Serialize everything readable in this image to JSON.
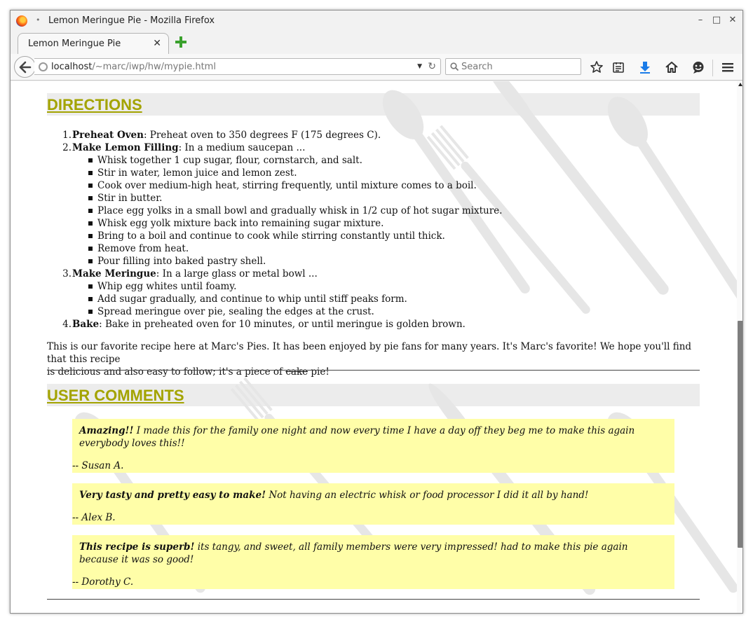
{
  "window": {
    "title": "Lemon Meringue Pie - Mozilla Firefox"
  },
  "tab": {
    "label": "Lemon Meringue Pie"
  },
  "url": {
    "host": "localhost",
    "path": "/~marc/iwp/hw/mypie.html"
  },
  "search": {
    "placeholder": "Search"
  },
  "directions": {
    "heading": "DIRECTIONS",
    "steps": [
      {
        "num": "1.",
        "title": "Preheat Oven",
        "text": ": Preheat oven to 350 degrees F (175 degrees C)."
      },
      {
        "num": "2.",
        "title": "Make Lemon Filling",
        "text": ": In a medium saucepan ...",
        "subs": [
          "Whisk together 1 cup sugar, flour, cornstarch, and salt.",
          "Stir in water, lemon juice and lemon zest.",
          "Cook over medium-high heat, stirring frequently, until mixture comes to a boil.",
          "Stir in butter.",
          "Place egg yolks in a small bowl and gradually whisk in 1/2 cup of hot sugar mixture.",
          "Whisk egg yolk mixture back into remaining sugar mixture.",
          "Bring to a boil and continue to cook while stirring constantly until thick.",
          "Remove from heat.",
          "Pour filling into baked pastry shell."
        ]
      },
      {
        "num": "3.",
        "title": "Make Meringue",
        "text": ": In a large glass or metal bowl ...",
        "subs": [
          "Whip egg whites until foamy.",
          "Add sugar gradually, and continue to whip until stiff peaks form.",
          "Spread meringue over pie, sealing the edges at the crust."
        ]
      },
      {
        "num": "4.",
        "title": "Bake",
        "text": ": Bake in preheated oven for 10 minutes, or until meringue is golden brown."
      }
    ]
  },
  "intro": {
    "line1": "This is our favorite recipe here at Marc's Pies. It has been enjoyed by pie fans for many years. It's Marc's favorite! We hope you'll find that this recipe",
    "line2_before": "is delicious and also easy to follow; it's a piece of ",
    "struck": "cake",
    "line2_after": " pie!"
  },
  "comments": {
    "heading": "USER COMMENTS",
    "items": [
      {
        "title": "Amazing!!",
        "text": " I made this for the family one night and now every time I have a day off they beg me to make this again everybody loves this!!",
        "author": "-- Susan A."
      },
      {
        "title": "Very tasty and pretty easy to make!",
        "text": " Not having an electric whisk or food processor I did it all by hand!",
        "author": "-- Alex B."
      },
      {
        "title": "This recipe is superb!",
        "text": " its tangy, and sweet, all family members were very impressed! had to make this pie again because it was so good!",
        "author": "-- Dorothy C."
      }
    ]
  },
  "colors": {
    "heading": "#a3a300",
    "comment_bg": "#fffea8",
    "heading_bg": "#ececec"
  },
  "icons": [
    "firefox-logo",
    "back-arrow",
    "globe",
    "reload",
    "search",
    "bookmark-star",
    "reading-list",
    "download-arrow",
    "home",
    "chat-bubble",
    "menu-hamburger"
  ]
}
